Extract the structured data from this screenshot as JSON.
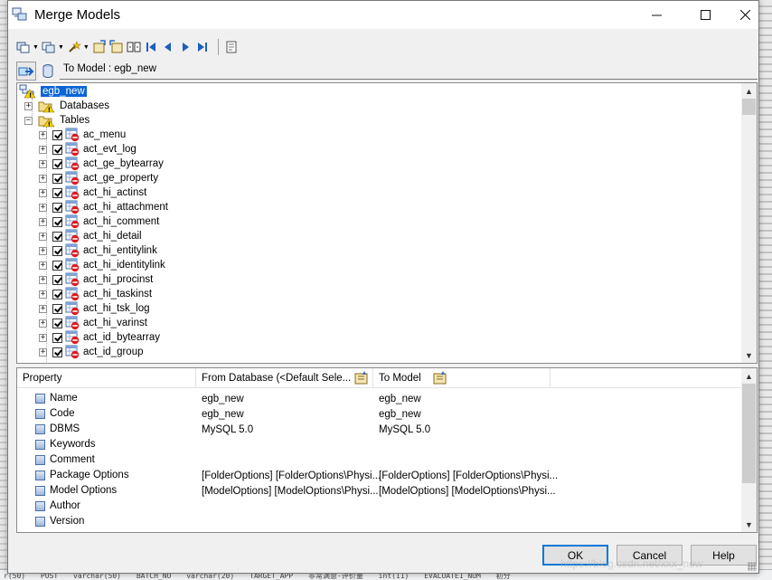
{
  "window": {
    "title": "Merge Models"
  },
  "to_model_label": "To Model : egb_new",
  "tree": {
    "root": "egb_new",
    "groups": [
      {
        "label": "Databases"
      },
      {
        "label": "Tables"
      }
    ],
    "tables": [
      "ac_menu",
      "act_evt_log",
      "act_ge_bytearray",
      "act_ge_property",
      "act_hi_actinst",
      "act_hi_attachment",
      "act_hi_comment",
      "act_hi_detail",
      "act_hi_entitylink",
      "act_hi_identitylink",
      "act_hi_procinst",
      "act_hi_taskinst",
      "act_hi_tsk_log",
      "act_hi_varinst",
      "act_id_bytearray",
      "act_id_group"
    ]
  },
  "properties": {
    "headers": [
      "Property",
      "From Database (<Default Sele...",
      "To Model"
    ],
    "rows": [
      {
        "name": "Name",
        "from": "egb_new",
        "to": "egb_new"
      },
      {
        "name": "Code",
        "from": "egb_new",
        "to": "egb_new"
      },
      {
        "name": "DBMS",
        "from": "MySQL 5.0",
        "to": "MySQL 5.0"
      },
      {
        "name": "Keywords",
        "from": "",
        "to": ""
      },
      {
        "name": "Comment",
        "from": "",
        "to": ""
      },
      {
        "name": "Package Options",
        "from": "[FolderOptions]  [FolderOptions\\Physi...",
        "to": "[FolderOptions]  [FolderOptions\\Physi..."
      },
      {
        "name": "Model Options",
        "from": "[ModelOptions]  [ModelOptions\\Physi...",
        "to": "[ModelOptions]  [ModelOptions\\Physi..."
      },
      {
        "name": "Author",
        "from": "",
        "to": ""
      },
      {
        "name": "Version",
        "from": "",
        "to": ""
      }
    ]
  },
  "buttons": {
    "ok": "OK",
    "cancel": "Cancel",
    "help": "Help"
  },
  "background_strip": [
    "r(50)",
    "POST",
    "varchar(50)",
    "BATCH_NO",
    "varchar(20)",
    "TARGET_APP",
    "非常满意-评价量",
    "int(11)",
    "EVALUATE1_NUM",
    "初分"
  ],
  "watermark": "https://blog.csdn.net/xxx_new"
}
